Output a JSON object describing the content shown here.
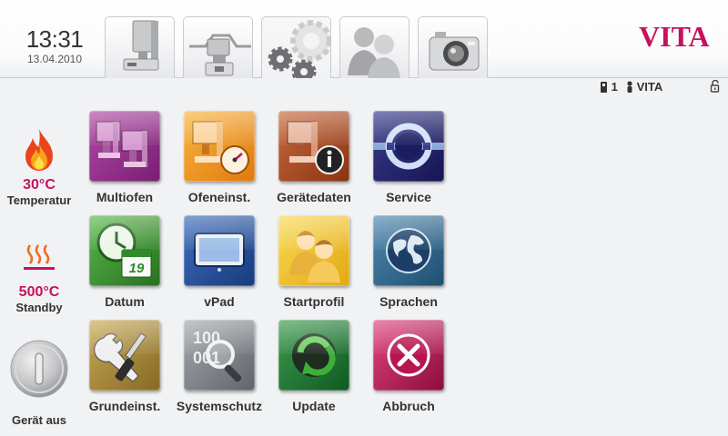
{
  "header": {
    "time": "13:31",
    "date": "13.04.2010",
    "logo": "VITA",
    "tabs": [
      {
        "icon": "furnace-icon",
        "active": false
      },
      {
        "icon": "furnace-program-icon",
        "active": false
      },
      {
        "icon": "gears-icon",
        "active": true
      },
      {
        "icon": "users-icon",
        "active": false
      },
      {
        "icon": "camera-icon",
        "active": false
      }
    ]
  },
  "status": {
    "device_number": "1",
    "user": "VITA"
  },
  "side": {
    "temperature_value": "30°C",
    "temperature_label": "Temperatur",
    "standby_value": "500°C",
    "standby_label": "Standby",
    "power_label": "Gerät aus"
  },
  "tiles": [
    {
      "label": "Multiofen",
      "icon": "multi-furnace-icon",
      "color": "#8e2a86"
    },
    {
      "label": "Ofeneinst.",
      "icon": "furnace-settings-icon",
      "color": "#f0901e"
    },
    {
      "label": "Gerätedaten",
      "icon": "device-info-icon",
      "color": "#a8481e"
    },
    {
      "label": "Service",
      "icon": "service-ring-icon",
      "color": "#2a2a78"
    },
    {
      "label": "Datum",
      "icon": "clock-calendar-icon",
      "color": "#3e9a36"
    },
    {
      "label": "vPad",
      "icon": "tablet-icon",
      "color": "#244f9e"
    },
    {
      "label": "Startprofil",
      "icon": "profile-users-icon",
      "color": "#f2c21c"
    },
    {
      "label": "Sprachen",
      "icon": "globe-icon",
      "color": "#2e6c92"
    },
    {
      "label": "Grundeinst.",
      "icon": "tools-icon",
      "color": "#a88a3c"
    },
    {
      "label": "Systemschutz",
      "icon": "magnifier-binary-icon",
      "color": "#7d8288"
    },
    {
      "label": "Update",
      "icon": "update-arrow-icon",
      "color": "#1f7a35"
    },
    {
      "label": "Abbruch",
      "icon": "cancel-x-icon",
      "color": "#c4175d"
    }
  ]
}
